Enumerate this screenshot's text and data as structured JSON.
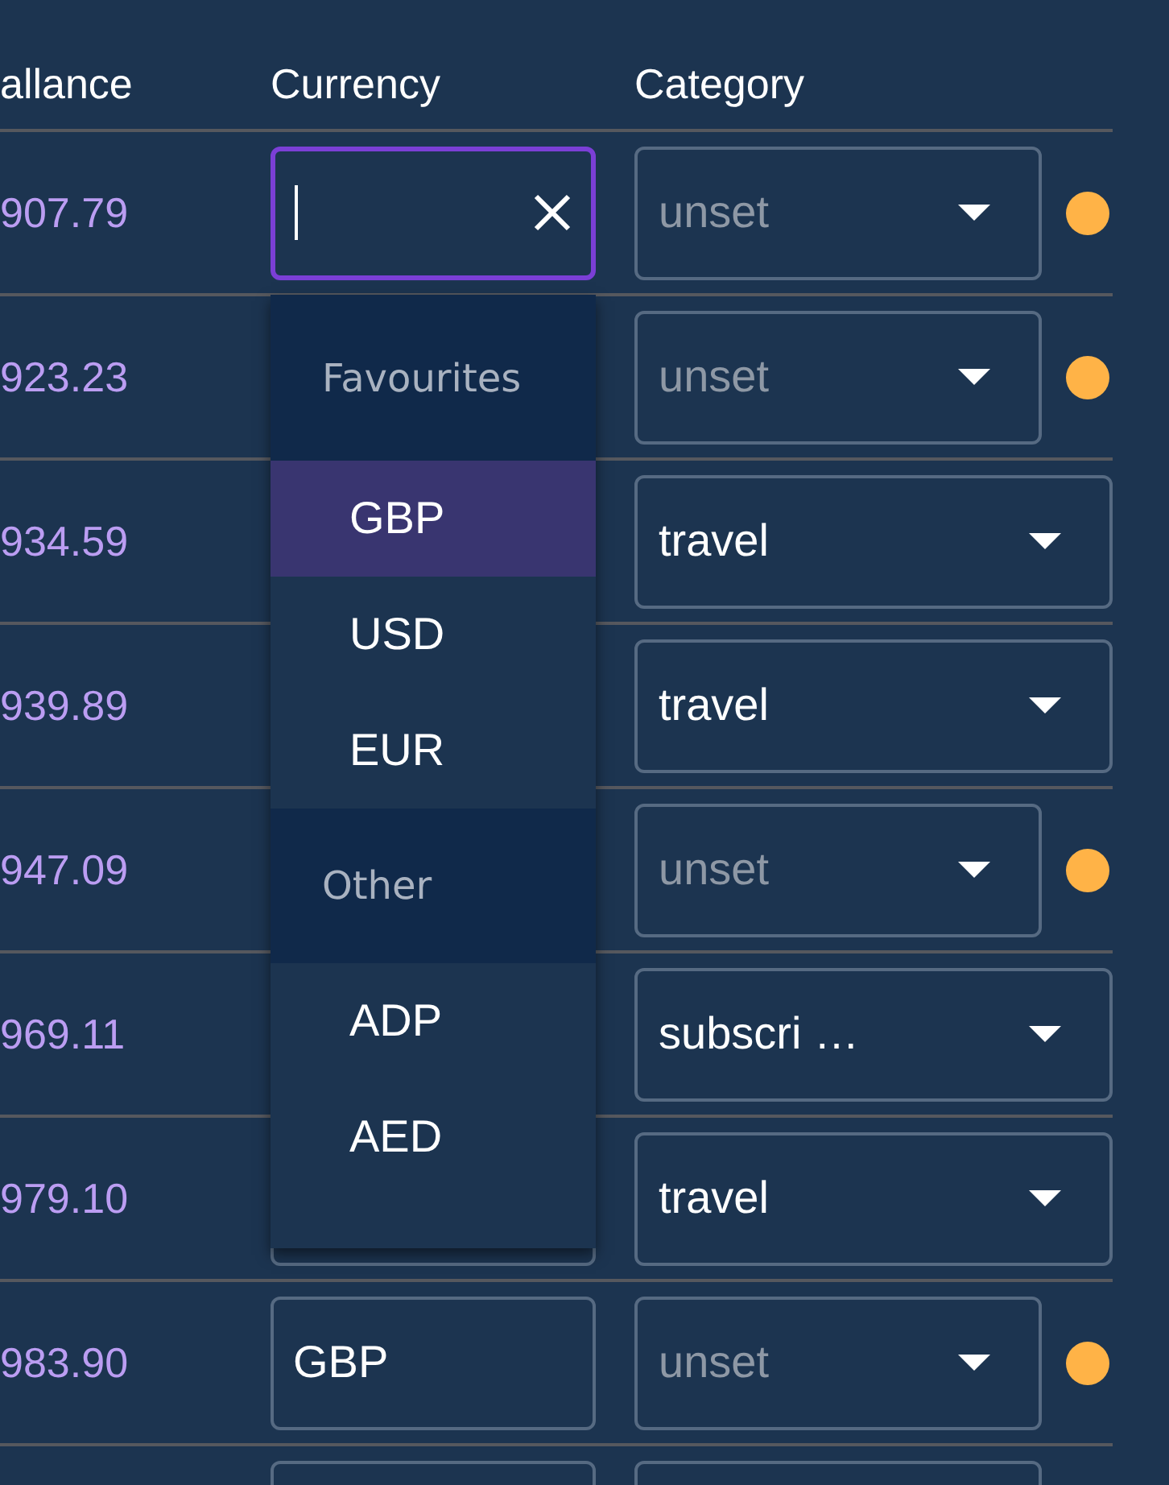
{
  "table": {
    "columns": [
      "allance",
      "Currency",
      "Category"
    ],
    "rows": [
      {
        "balance": "907.79",
        "currency": {
          "focused": true
        },
        "category": {
          "placeholder": "unset"
        }
      },
      {
        "balance": "923.23",
        "currency": {},
        "category": {
          "placeholder": "unset"
        }
      },
      {
        "balance": "934.59",
        "currency": {},
        "category": {
          "value": "travel"
        }
      },
      {
        "balance": "939.89",
        "currency": {},
        "category": {
          "value": "travel"
        }
      },
      {
        "balance": "947.09",
        "currency": {},
        "category": {
          "placeholder": "unset"
        }
      },
      {
        "balance": "969.11",
        "currency": {},
        "category": {
          "value": "subscri …"
        }
      },
      {
        "balance": "979.10",
        "currency": {
          "focused": false
        },
        "category": {
          "value": "travel"
        }
      },
      {
        "balance": "983.90",
        "currency": {
          "value": "GBP",
          "focused": false
        },
        "category": {
          "placeholder": "unset"
        }
      },
      {
        "currency": {
          "focused": false
        },
        "category": {}
      }
    ]
  },
  "currency_dropdown": {
    "groups": [
      {
        "label": "Favourites",
        "options": [
          {
            "label": "GBP",
            "selected": true
          },
          {
            "label": "USD",
            "selected": false
          },
          {
            "label": "EUR",
            "selected": false
          }
        ]
      },
      {
        "label": "Other",
        "options": [
          {
            "label": "ADP",
            "selected": false
          },
          {
            "label": "AED",
            "selected": false
          }
        ]
      }
    ]
  }
}
